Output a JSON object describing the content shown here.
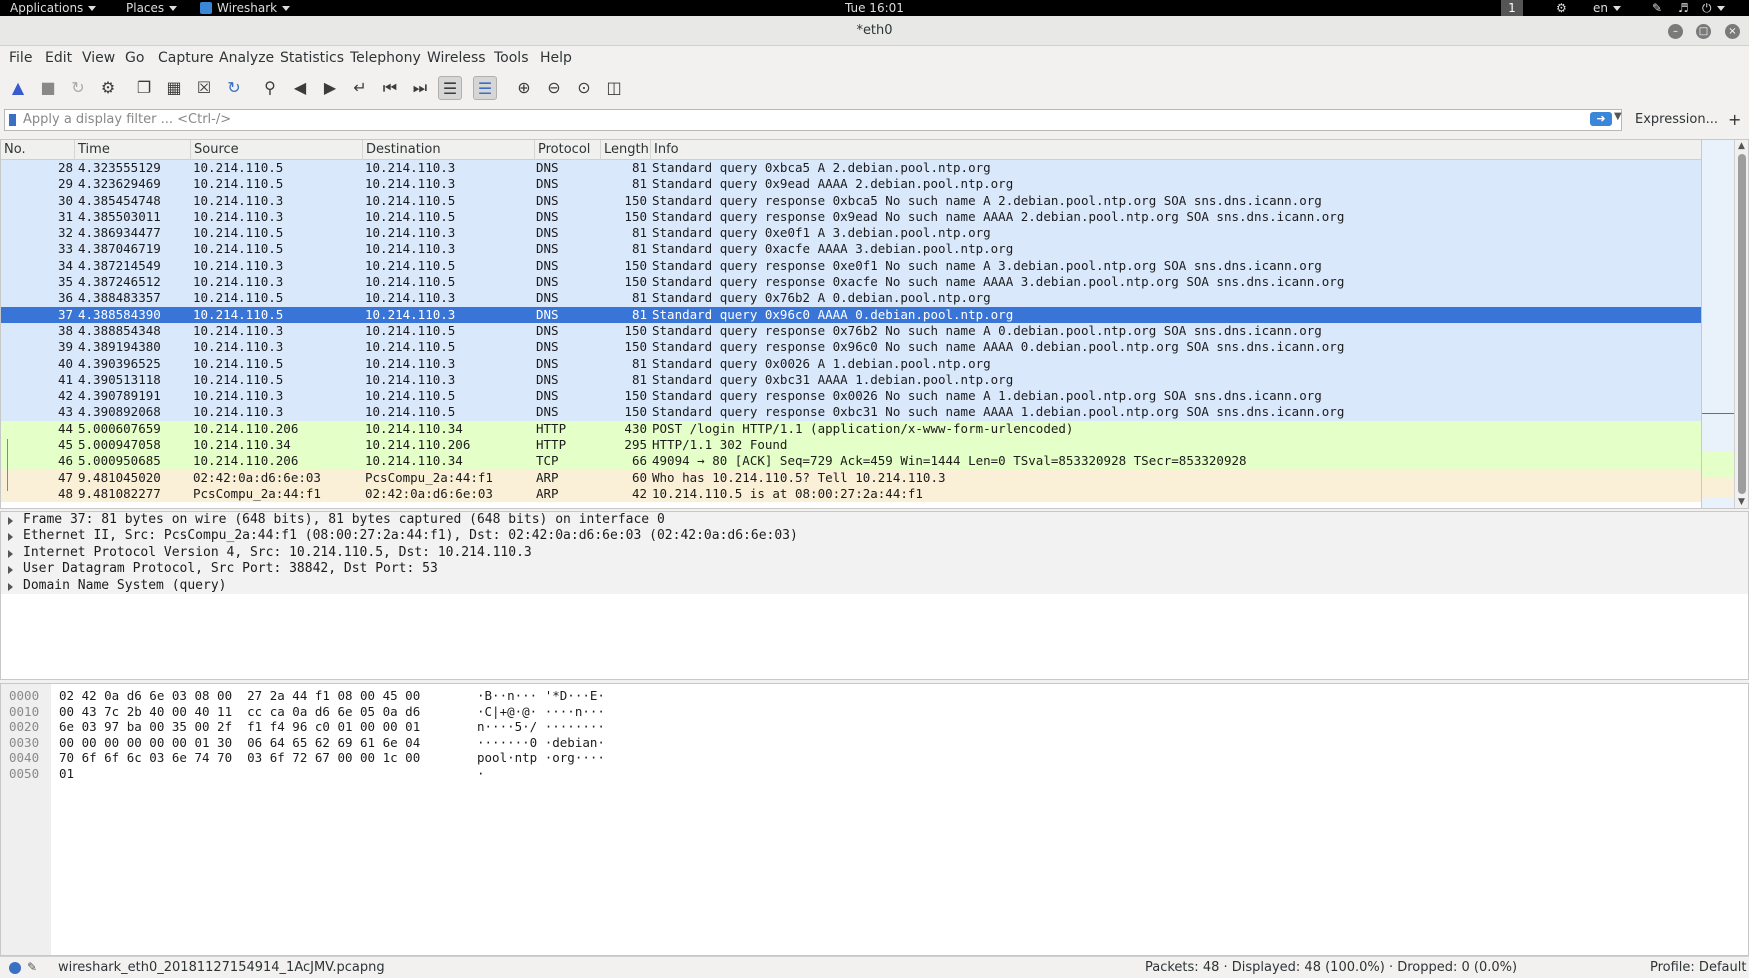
{
  "topbar": {
    "applications": "Applications",
    "places": "Places",
    "app": "Wireshark",
    "clock": "Tue 16:01",
    "workspace": "1",
    "lang": "en"
  },
  "window": {
    "title": "*eth0"
  },
  "menu": [
    "File",
    "Edit",
    "View",
    "Go",
    "Capture",
    "Analyze",
    "Statistics",
    "Telephony",
    "Wireless",
    "Tools",
    "Help"
  ],
  "filter": {
    "placeholder": "Apply a display filter ... <Ctrl-/>",
    "expression": "Expression...",
    "plus": "+"
  },
  "columns": [
    "No.",
    "Time",
    "Source",
    "Destination",
    "Protocol",
    "Length",
    "Info"
  ],
  "selected_packet": 37,
  "packets": [
    {
      "no": "28",
      "time": "4.323555129",
      "src": "10.214.110.5",
      "dst": "10.214.110.3",
      "proto": "DNS",
      "len": "81",
      "info": "Standard query 0xbca5 A 2.debian.pool.ntp.org",
      "cls": "dns"
    },
    {
      "no": "29",
      "time": "4.323629469",
      "src": "10.214.110.5",
      "dst": "10.214.110.3",
      "proto": "DNS",
      "len": "81",
      "info": "Standard query 0x9ead AAAA 2.debian.pool.ntp.org",
      "cls": "dns"
    },
    {
      "no": "30",
      "time": "4.385454748",
      "src": "10.214.110.3",
      "dst": "10.214.110.5",
      "proto": "DNS",
      "len": "150",
      "info": "Standard query response 0xbca5 No such name A 2.debian.pool.ntp.org SOA sns.dns.icann.org",
      "cls": "dns"
    },
    {
      "no": "31",
      "time": "4.385503011",
      "src": "10.214.110.3",
      "dst": "10.214.110.5",
      "proto": "DNS",
      "len": "150",
      "info": "Standard query response 0x9ead No such name AAAA 2.debian.pool.ntp.org SOA sns.dns.icann.org",
      "cls": "dns"
    },
    {
      "no": "32",
      "time": "4.386934477",
      "src": "10.214.110.5",
      "dst": "10.214.110.3",
      "proto": "DNS",
      "len": "81",
      "info": "Standard query 0xe0f1 A 3.debian.pool.ntp.org",
      "cls": "dns"
    },
    {
      "no": "33",
      "time": "4.387046719",
      "src": "10.214.110.5",
      "dst": "10.214.110.3",
      "proto": "DNS",
      "len": "81",
      "info": "Standard query 0xacfe AAAA 3.debian.pool.ntp.org",
      "cls": "dns"
    },
    {
      "no": "34",
      "time": "4.387214549",
      "src": "10.214.110.3",
      "dst": "10.214.110.5",
      "proto": "DNS",
      "len": "150",
      "info": "Standard query response 0xe0f1 No such name A 3.debian.pool.ntp.org SOA sns.dns.icann.org",
      "cls": "dns"
    },
    {
      "no": "35",
      "time": "4.387246512",
      "src": "10.214.110.3",
      "dst": "10.214.110.5",
      "proto": "DNS",
      "len": "150",
      "info": "Standard query response 0xacfe No such name AAAA 3.debian.pool.ntp.org SOA sns.dns.icann.org",
      "cls": "dns"
    },
    {
      "no": "36",
      "time": "4.388483357",
      "src": "10.214.110.5",
      "dst": "10.214.110.3",
      "proto": "DNS",
      "len": "81",
      "info": "Standard query 0x76b2 A 0.debian.pool.ntp.org",
      "cls": "dns"
    },
    {
      "no": "37",
      "time": "4.388584390",
      "src": "10.214.110.5",
      "dst": "10.214.110.3",
      "proto": "DNS",
      "len": "81",
      "info": "Standard query 0x96c0 AAAA 0.debian.pool.ntp.org",
      "cls": "dns"
    },
    {
      "no": "38",
      "time": "4.388854348",
      "src": "10.214.110.3",
      "dst": "10.214.110.5",
      "proto": "DNS",
      "len": "150",
      "info": "Standard query response 0x76b2 No such name A 0.debian.pool.ntp.org SOA sns.dns.icann.org",
      "cls": "dns"
    },
    {
      "no": "39",
      "time": "4.389194380",
      "src": "10.214.110.3",
      "dst": "10.214.110.5",
      "proto": "DNS",
      "len": "150",
      "info": "Standard query response 0x96c0 No such name AAAA 0.debian.pool.ntp.org SOA sns.dns.icann.org",
      "cls": "dns"
    },
    {
      "no": "40",
      "time": "4.390396525",
      "src": "10.214.110.5",
      "dst": "10.214.110.3",
      "proto": "DNS",
      "len": "81",
      "info": "Standard query 0x0026 A 1.debian.pool.ntp.org",
      "cls": "dns"
    },
    {
      "no": "41",
      "time": "4.390513118",
      "src": "10.214.110.5",
      "dst": "10.214.110.3",
      "proto": "DNS",
      "len": "81",
      "info": "Standard query 0xbc31 AAAA 1.debian.pool.ntp.org",
      "cls": "dns"
    },
    {
      "no": "42",
      "time": "4.390789191",
      "src": "10.214.110.3",
      "dst": "10.214.110.5",
      "proto": "DNS",
      "len": "150",
      "info": "Standard query response 0x0026 No such name A 1.debian.pool.ntp.org SOA sns.dns.icann.org",
      "cls": "dns"
    },
    {
      "no": "43",
      "time": "4.390892068",
      "src": "10.214.110.3",
      "dst": "10.214.110.5",
      "proto": "DNS",
      "len": "150",
      "info": "Standard query response 0xbc31 No such name AAAA 1.debian.pool.ntp.org SOA sns.dns.icann.org",
      "cls": "dns"
    },
    {
      "no": "44",
      "time": "5.000607659",
      "src": "10.214.110.206",
      "dst": "10.214.110.34",
      "proto": "HTTP",
      "len": "430",
      "info": "POST /login HTTP/1.1  (application/x-www-form-urlencoded)",
      "cls": "http"
    },
    {
      "no": "45",
      "time": "5.000947058",
      "src": "10.214.110.34",
      "dst": "10.214.110.206",
      "proto": "HTTP",
      "len": "295",
      "info": "HTTP/1.1 302 Found",
      "cls": "http"
    },
    {
      "no": "46",
      "time": "5.000950685",
      "src": "10.214.110.206",
      "dst": "10.214.110.34",
      "proto": "TCP",
      "len": "66",
      "info": "49094 → 80 [ACK] Seq=729 Ack=459 Win=1444 Len=0 TSval=853320928 TSecr=853320928",
      "cls": "tcp2"
    },
    {
      "no": "47",
      "time": "9.481045020",
      "src": "02:42:0a:d6:6e:03",
      "dst": "PcsCompu_2a:44:f1",
      "proto": "ARP",
      "len": "60",
      "info": "Who has 10.214.110.5? Tell 10.214.110.3",
      "cls": "arp"
    },
    {
      "no": "48",
      "time": "9.481082277",
      "src": "PcsCompu_2a:44:f1",
      "dst": "02:42:0a:d6:6e:03",
      "proto": "ARP",
      "len": "42",
      "info": "10.214.110.5 is at 08:00:27:2a:44:f1",
      "cls": "arp"
    }
  ],
  "details": [
    "Frame 37: 81 bytes on wire (648 bits), 81 bytes captured (648 bits) on interface 0",
    "Ethernet II, Src: PcsCompu_2a:44:f1 (08:00:27:2a:44:f1), Dst: 02:42:0a:d6:6e:03 (02:42:0a:d6:6e:03)",
    "Internet Protocol Version 4, Src: 10.214.110.5, Dst: 10.214.110.3",
    "User Datagram Protocol, Src Port: 38842, Dst Port: 53",
    "Domain Name System (query)"
  ],
  "bytes": [
    {
      "off": "0000",
      "hex": "02 42 0a d6 6e 03 08 00  27 2a 44 f1 08 00 45 00",
      "ascii": "·B··n··· '*D···E·"
    },
    {
      "off": "0010",
      "hex": "00 43 7c 2b 40 00 40 11  cc ca 0a d6 6e 05 0a d6",
      "ascii": "·C|+@·@· ····n···"
    },
    {
      "off": "0020",
      "hex": "6e 03 97 ba 00 35 00 2f  f1 f4 96 c0 01 00 00 01",
      "ascii": "n····5·/ ········"
    },
    {
      "off": "0030",
      "hex": "00 00 00 00 00 00 01 30  06 64 65 62 69 61 6e 04",
      "ascii": "·······0 ·debian·"
    },
    {
      "off": "0040",
      "hex": "70 6f 6f 6c 03 6e 74 70  03 6f 72 67 00 00 1c 00",
      "ascii": "pool·ntp ·org····"
    },
    {
      "off": "0050",
      "hex": "01",
      "ascii": "·"
    }
  ],
  "status": {
    "file": "wireshark_eth0_20181127154914_1AcJMV.pcapng",
    "packets": "Packets: 48 · Displayed: 48 (100.0%) · Dropped: 0 (0.0%)",
    "profile": "Profile: Default"
  },
  "icons": [
    "shark-fin-icon",
    "stop-icon",
    "restart-icon",
    "options-gear-icon",
    "open-icon",
    "save-icon",
    "close-file-icon",
    "reload-icon",
    "find-icon",
    "back-icon",
    "forward-icon",
    "goto-icon",
    "first-icon",
    "last-icon",
    "autoscroll-icon",
    "colorize-icon",
    "zoom-in-icon",
    "zoom-out-icon",
    "zoom-normal-icon",
    "resize-columns-icon"
  ],
  "colors": {
    "selected": "#3875d7",
    "dns": "#dae8fc",
    "http": "#e4ffc7",
    "arp": "#faf0d7",
    "filter_apply": "#3a86d8"
  }
}
